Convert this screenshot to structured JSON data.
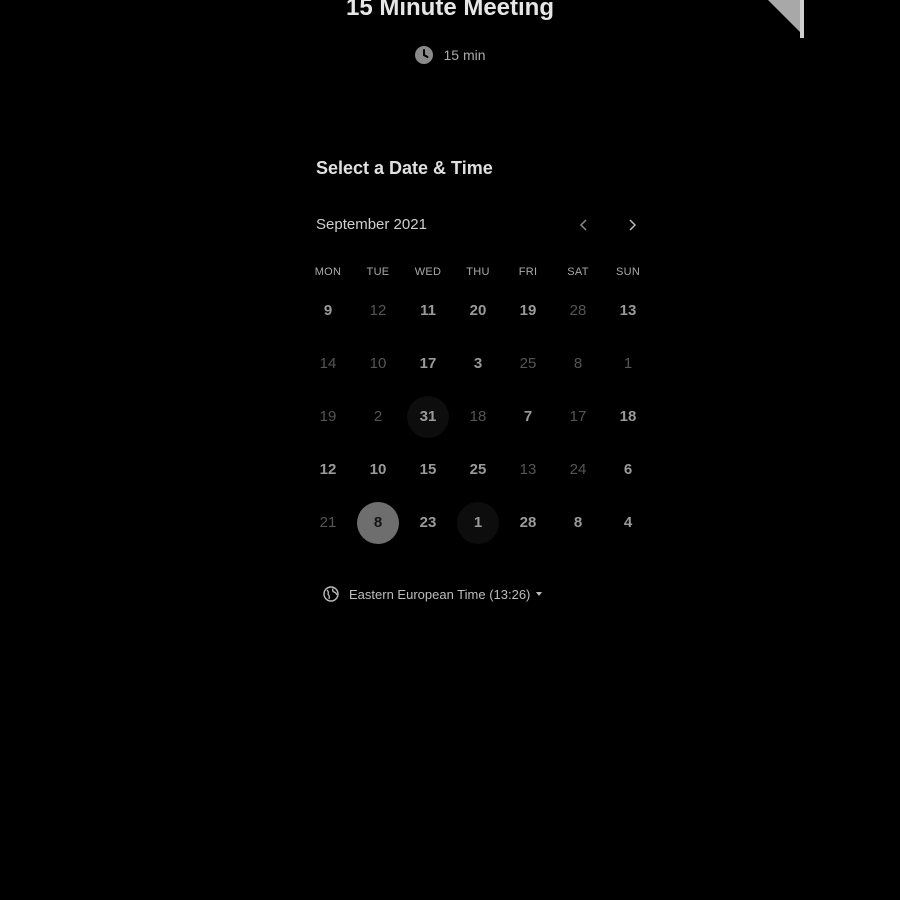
{
  "event": {
    "title": "15 Minute Meeting",
    "duration": "15 min",
    "duration_icon": "clock-icon"
  },
  "picker": {
    "heading": "Select a Date & Time",
    "month": "September 2021",
    "prev_icon": "chevron-left-icon",
    "next_icon": "chevron-right-icon",
    "weekdays": [
      "MON",
      "TUE",
      "WED",
      "THU",
      "FRI",
      "SAT",
      "SUN"
    ],
    "weeks": [
      [
        {
          "label": "9",
          "available": true
        },
        {
          "label": "12",
          "available": false
        },
        {
          "label": "11",
          "available": true
        },
        {
          "label": "20",
          "available": true
        },
        {
          "label": "19",
          "available": true
        },
        {
          "label": "28",
          "available": false
        },
        {
          "label": "13",
          "available": true
        }
      ],
      [
        {
          "label": "14",
          "available": false
        },
        {
          "label": "10",
          "available": false
        },
        {
          "label": "17",
          "available": true
        },
        {
          "label": "3",
          "available": true
        },
        {
          "label": "25",
          "available": false
        },
        {
          "label": "8",
          "available": false
        },
        {
          "label": "1",
          "available": false
        }
      ],
      [
        {
          "label": "19",
          "available": false
        },
        {
          "label": "2",
          "available": false
        },
        {
          "label": "31",
          "available": true,
          "shaded": true
        },
        {
          "label": "18",
          "available": false
        },
        {
          "label": "7",
          "available": true
        },
        {
          "label": "17",
          "available": false
        },
        {
          "label": "18",
          "available": true
        }
      ],
      [
        {
          "label": "12",
          "available": true
        },
        {
          "label": "10",
          "available": true
        },
        {
          "label": "15",
          "available": true
        },
        {
          "label": "25",
          "available": true
        },
        {
          "label": "13",
          "available": false
        },
        {
          "label": "24",
          "available": false
        },
        {
          "label": "6",
          "available": true
        }
      ],
      [
        {
          "label": "21",
          "available": false
        },
        {
          "label": "8",
          "available": true,
          "selected": true
        },
        {
          "label": "23",
          "available": true
        },
        {
          "label": "1",
          "available": true,
          "shaded": true
        },
        {
          "label": "28",
          "available": true
        },
        {
          "label": "8",
          "available": true
        },
        {
          "label": "4",
          "available": true
        }
      ]
    ]
  },
  "timezone": {
    "label": "Eastern European Time (13:26)",
    "icon": "globe-icon"
  },
  "colors": {
    "background": "#000000",
    "selected_day": "#6e6e6e",
    "available_day_text": "#9a9a9a",
    "unavailable_day_text": "#555555"
  }
}
